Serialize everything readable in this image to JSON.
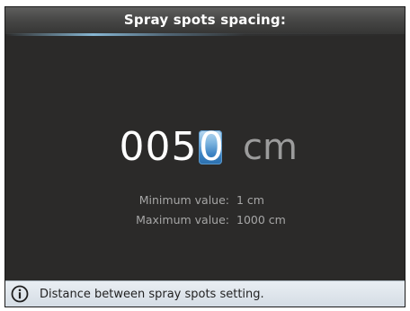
{
  "header": {
    "title": "Spray spots spacing:"
  },
  "value_editor": {
    "digits": [
      "0",
      "0",
      "5",
      "0"
    ],
    "active_digit_index": 3,
    "unit": "cm",
    "active_color": "#3c83c3"
  },
  "limits": {
    "min_label": "Minimum value:",
    "min_value": "1 cm",
    "max_label": "Maximum value:",
    "max_value": "1000 cm"
  },
  "footer": {
    "icon": "info-icon",
    "text": "Distance between spray spots setting."
  }
}
